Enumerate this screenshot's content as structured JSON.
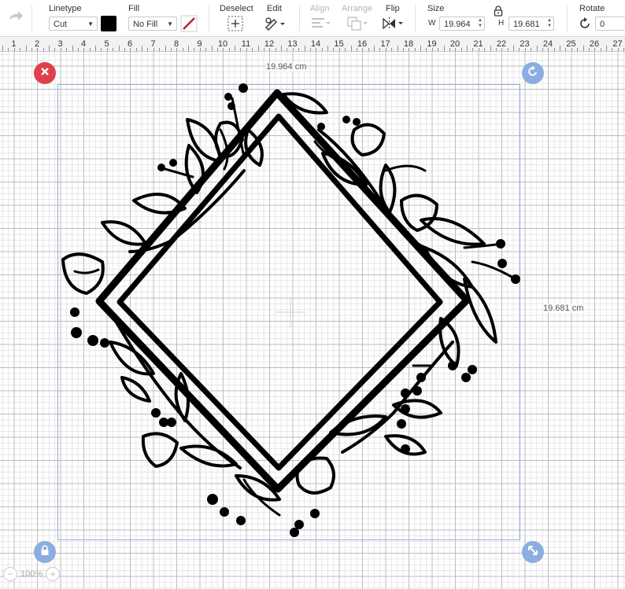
{
  "toolbar": {
    "linetype_label": "Linetype",
    "linetype_value": "Cut",
    "fill_label": "Fill",
    "fill_value": "No Fill",
    "deselect_label": "Deselect",
    "edit_label": "Edit",
    "align_label": "Align",
    "arrange_label": "Arrange",
    "flip_label": "Flip",
    "size_label": "Size",
    "width_letter": "W",
    "width_value": "19.964",
    "height_letter": "H",
    "height_value": "19.681",
    "rotate_label": "Rotate",
    "rotate_value": "0",
    "linetype_color": "#000000",
    "pen_color": "#c0202f"
  },
  "ruler": {
    "numbers": [
      "1",
      "2",
      "3",
      "4",
      "5",
      "6",
      "7",
      "8",
      "9",
      "10",
      "11",
      "12",
      "13",
      "14",
      "15",
      "16",
      "17",
      "18",
      "19",
      "20",
      "21",
      "22",
      "23",
      "24",
      "25",
      "26",
      "27"
    ]
  },
  "canvas": {
    "width_dimension": "19.964 cm",
    "height_dimension": "19.681 cm",
    "zoom_value": "100%",
    "delete_color": "#e0404e",
    "handle_color": "#8aaee0"
  },
  "icons": [
    "undo-icon",
    "pen-color-icon",
    "deselect-icon",
    "edit-icon",
    "align-icon",
    "arrange-icon",
    "flip-icon",
    "lock-icon",
    "rotate-icon",
    "delete-icon",
    "rotate-handle-icon",
    "lock-handle-icon",
    "resize-icon",
    "zoom-out-icon",
    "zoom-in-icon"
  ]
}
